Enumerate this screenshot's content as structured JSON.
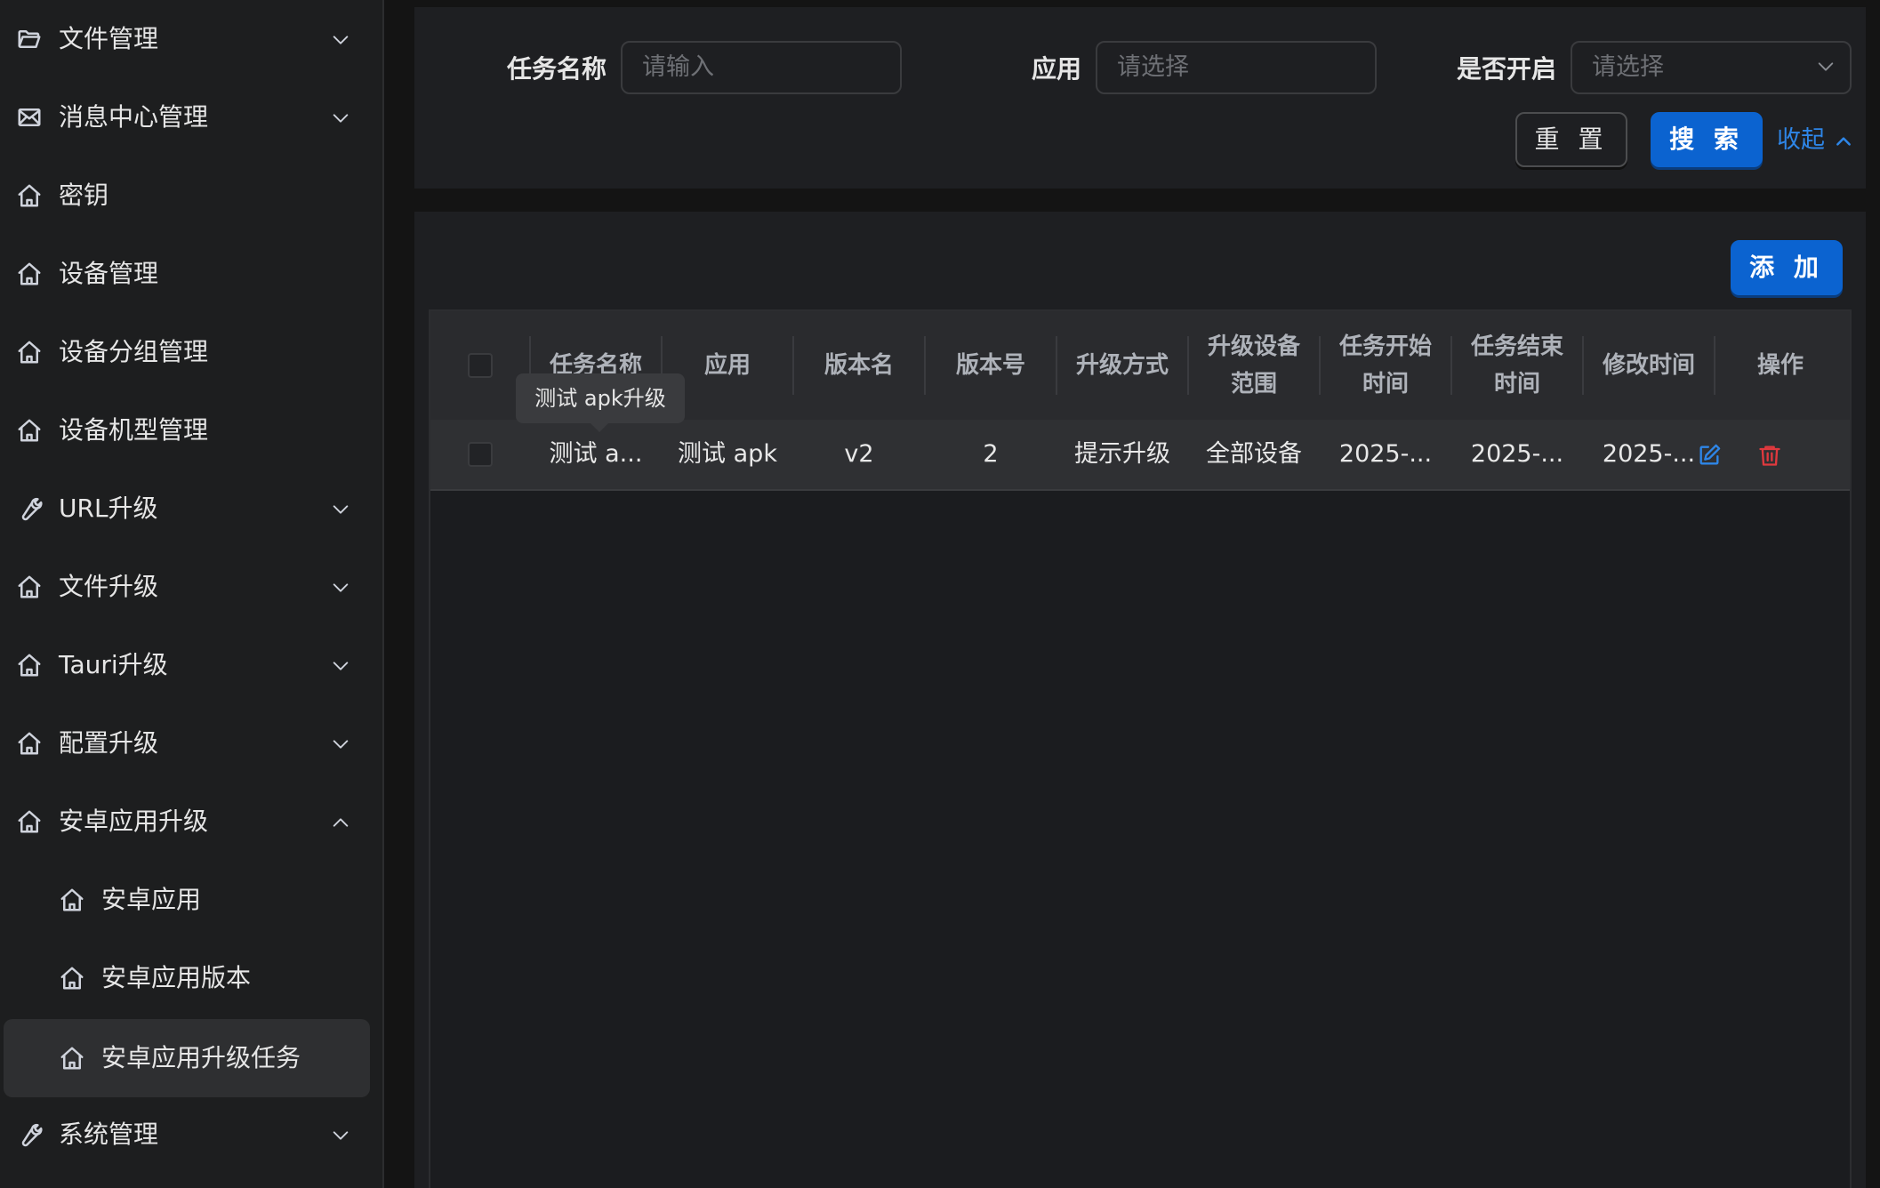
{
  "sidebar": {
    "items": [
      {
        "label": "文件管理",
        "icon": "folder-icon",
        "chevron": "down"
      },
      {
        "label": "消息中心管理",
        "icon": "mail-icon",
        "chevron": "down"
      },
      {
        "label": "密钥",
        "icon": "home-icon",
        "chevron": ""
      },
      {
        "label": "设备管理",
        "icon": "home-icon",
        "chevron": ""
      },
      {
        "label": "设备分组管理",
        "icon": "home-icon",
        "chevron": ""
      },
      {
        "label": "设备机型管理",
        "icon": "home-icon",
        "chevron": ""
      },
      {
        "label": "URL升级",
        "icon": "wrench-icon",
        "chevron": "down"
      },
      {
        "label": "文件升级",
        "icon": "home-icon",
        "chevron": "down"
      },
      {
        "label": "Tauri升级",
        "icon": "home-icon",
        "chevron": "down"
      },
      {
        "label": "配置升级",
        "icon": "home-icon",
        "chevron": "down"
      },
      {
        "label": "安卓应用升级",
        "icon": "home-icon",
        "chevron": "up"
      },
      {
        "label": "安卓应用",
        "icon": "home-icon",
        "chevron": "",
        "sub": true
      },
      {
        "label": "安卓应用版本",
        "icon": "home-icon",
        "chevron": "",
        "sub": true
      },
      {
        "label": "安卓应用升级任务",
        "icon": "home-icon",
        "chevron": "",
        "sub": true,
        "active": true
      },
      {
        "label": "系统管理",
        "icon": "wrench-icon",
        "chevron": "down"
      }
    ]
  },
  "search": {
    "task_name_label": "任务名称",
    "task_name_placeholder": "请输入",
    "app_label": "应用",
    "app_placeholder": "请选择",
    "enabled_label": "是否开启",
    "enabled_placeholder": "请选择",
    "reset_label": "重 置",
    "search_label": "搜 索",
    "collapse_label": "收起"
  },
  "table": {
    "add_label": "添 加",
    "columns": [
      "任务名称",
      "应用",
      "版本名",
      "版本号",
      "升级方式",
      "升级设备\n范围",
      "任务开始\n时间",
      "任务结束\n时间",
      "修改时间",
      "操作"
    ],
    "rows": [
      [
        "测试 a...",
        "测试 apk",
        "v2",
        "2",
        "提示升级",
        "全部设备",
        "2025-...",
        "2025-...",
        "2025-..."
      ]
    ],
    "tooltip": "测试 apk升级"
  },
  "colors": {
    "accent": "#0b63d0",
    "link": "#2e86e8",
    "delete": "#e0393e"
  }
}
